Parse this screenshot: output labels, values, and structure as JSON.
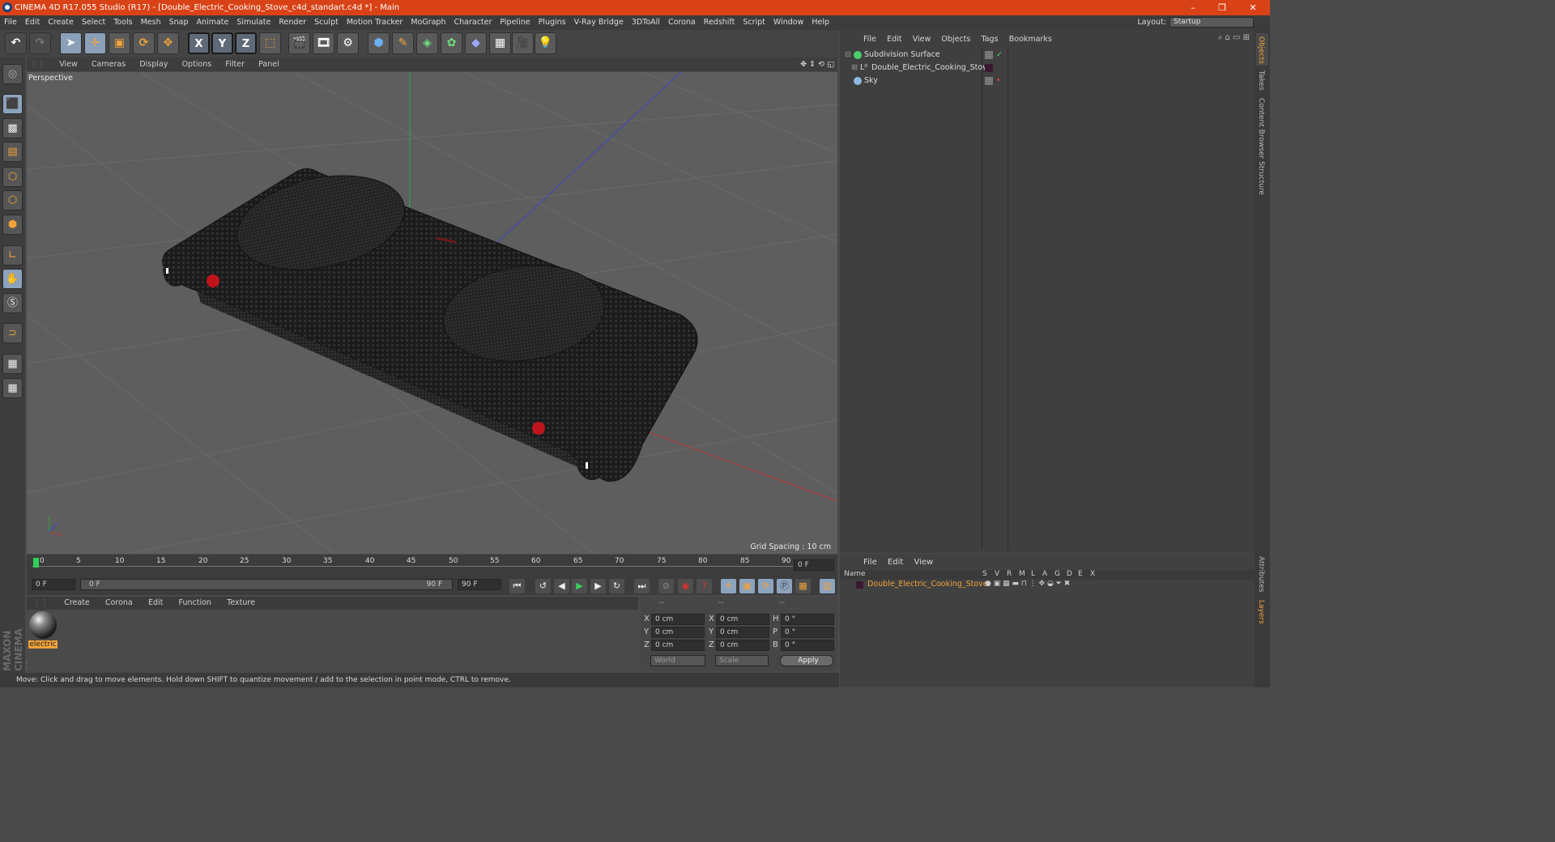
{
  "window": {
    "title": "CINEMA 4D R17.055 Studio (R17) - [Double_Electric_Cooking_Stove_c4d_standart.c4d *] - Main",
    "minimize": "–",
    "restore": "❐",
    "close": "✕"
  },
  "menubar": {
    "items": [
      "File",
      "Edit",
      "Create",
      "Select",
      "Tools",
      "Mesh",
      "Snap",
      "Animate",
      "Simulate",
      "Render",
      "Sculpt",
      "Motion Tracker",
      "MoGraph",
      "Character",
      "Pipeline",
      "Plugins",
      "V-Ray Bridge",
      "3DToAll",
      "Corona",
      "Redshift",
      "Script",
      "Window",
      "Help"
    ],
    "layout_label": "Layout:",
    "layout_value": "Startup"
  },
  "toolbar": {
    "axis_x": "X",
    "axis_y": "Y",
    "axis_z": "Z"
  },
  "viewport": {
    "menu": [
      "View",
      "Cameras",
      "Display",
      "Options",
      "Filter",
      "Panel"
    ],
    "label": "Perspective",
    "grid_spacing": "Grid Spacing : 10 cm"
  },
  "timeline": {
    "ticks": [
      "0",
      "5",
      "10",
      "15",
      "20",
      "25",
      "30",
      "35",
      "40",
      "45",
      "50",
      "55",
      "60",
      "65",
      "70",
      "75",
      "80",
      "85",
      "90"
    ],
    "end_frame": "0 F"
  },
  "transport": {
    "start": "0 F",
    "range_start": "0 F",
    "range_end": "90 F",
    "end": "90 F"
  },
  "material_menu": [
    "Create",
    "Corona",
    "Edit",
    "Function",
    "Texture"
  ],
  "material": {
    "name": "electric"
  },
  "coords": {
    "header1": "--",
    "header2": "--",
    "header3": "--",
    "rows": [
      {
        "a": "X",
        "av": "0 cm",
        "b": "X",
        "bv": "0 cm",
        "c": "H",
        "cv": "0 °"
      },
      {
        "a": "Y",
        "av": "0 cm",
        "b": "Y",
        "bv": "0 cm",
        "c": "P",
        "cv": "0 °"
      },
      {
        "a": "Z",
        "av": "0 cm",
        "b": "Z",
        "bv": "0 cm",
        "c": "B",
        "cv": "0 °"
      }
    ],
    "world": "World",
    "scale": "Scale",
    "apply": "Apply"
  },
  "status": "Move: Click and drag to move elements. Hold down SHIFT to quantize movement / add to the selection in point mode, CTRL to remove.",
  "object_manager": {
    "menu": [
      "File",
      "Edit",
      "View",
      "Objects",
      "Tags",
      "Bookmarks"
    ],
    "objects": [
      "Subdivision Surface",
      "Double_Electric_Cooking_Stove",
      "Sky"
    ]
  },
  "layer_manager": {
    "menu": [
      "File",
      "Edit",
      "View"
    ],
    "col_name": "Name",
    "cols": [
      "S",
      "V",
      "R",
      "M",
      "L",
      "A",
      "G",
      "D",
      "E",
      "X"
    ],
    "layer": "Double_Electric_Cooking_Stove"
  },
  "side_tabs": [
    "Objects",
    "Takes",
    "Content Browser",
    "Structure"
  ],
  "side_tabs2": [
    "Attributes",
    "Layers"
  ],
  "brand": "MAXON CINEMA 4D"
}
